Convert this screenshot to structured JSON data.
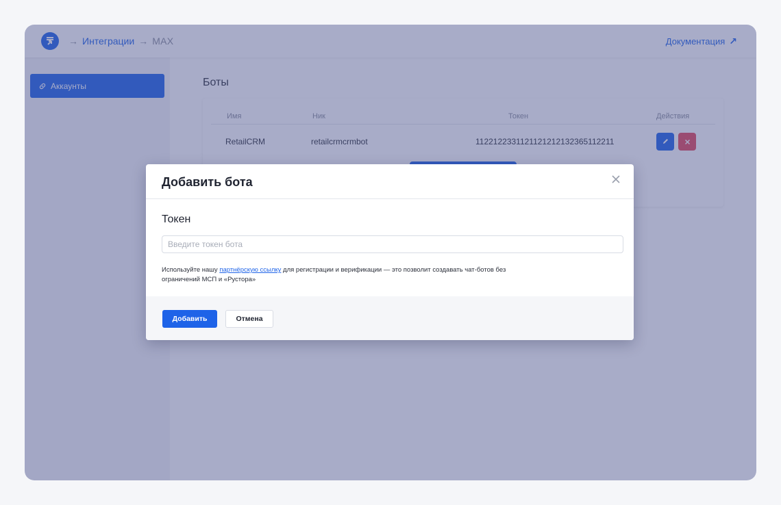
{
  "header": {
    "breadcrumb": {
      "separator": "→",
      "integrations": "Интеграции",
      "current": "MAX"
    },
    "docs_label": "Документация",
    "docs_icon": "external-arrow-icon",
    "logo_icon": "retailcrm-logo-icon"
  },
  "sidebar": {
    "items": [
      {
        "label": "Аккаунты",
        "icon": "link-icon",
        "active": true
      }
    ]
  },
  "main": {
    "section_title": "Боты",
    "table": {
      "headers": {
        "name": "Имя",
        "nick": "Ник",
        "token": "Токен",
        "actions": "Действия"
      },
      "rows": [
        {
          "name": "RetailCRM",
          "nick": "retailcrmcrmbot",
          "token": "11221223311211212121323651122​11"
        }
      ],
      "action_icons": {
        "edit": "pencil-icon",
        "delete": "close-icon"
      }
    }
  },
  "modal": {
    "title": "Добавить бота",
    "field_label": "Токен",
    "input_value": "",
    "input_placeholder": "Введите токен бота",
    "hint_before": "Используйте нашу ",
    "hint_link": "партнёрскую ссылку",
    "hint_after": " для регистрации и верификации — это позволит создавать чат-ботов без ограничений МСП и «Рустора»",
    "submit_label": "Добавить",
    "cancel_label": "Отмена"
  },
  "colors": {
    "accent": "#1e63e8",
    "danger": "#e5485a",
    "overlay": "rgba(74, 82, 140, 0.48)"
  }
}
